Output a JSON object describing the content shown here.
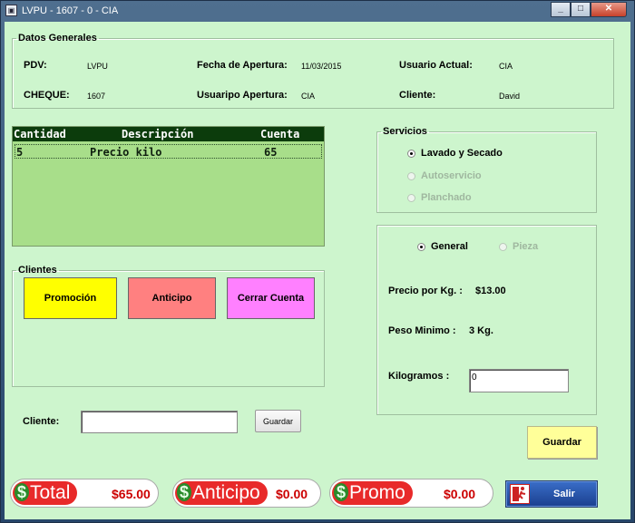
{
  "window": {
    "title": "LVPU - 1607 - 0 - CIA",
    "close_glyph": "✕",
    "minimize_glyph": "_",
    "maximize_glyph": "□"
  },
  "datos_generales": {
    "legend": "Datos Generales",
    "pdv_label": "PDV:",
    "pdv_value": "LVPU",
    "fecha_label": "Fecha de Apertura:",
    "fecha_value": "11/03/2015",
    "usuario_actual_label": "Usuario Actual:",
    "usuario_actual_value": "CIA",
    "cheque_label": "CHEQUE:",
    "cheque_value": "1607",
    "usuario_apertura_label": "Usuaripo Apertura:",
    "usuario_apertura_value": "CIA",
    "cliente_label": "Cliente:",
    "cliente_value": "David"
  },
  "grid": {
    "headers": [
      "Cantidad",
      "Descripción",
      "Cuenta"
    ],
    "rows": [
      {
        "cantidad": "5",
        "descripcion": "Precio kilo",
        "cuenta": "65"
      }
    ]
  },
  "servicios": {
    "legend": "Servicios",
    "options": [
      {
        "label": "Lavado y Secado",
        "selected": true,
        "enabled": true
      },
      {
        "label": "Autoservicio",
        "selected": false,
        "enabled": false
      },
      {
        "label": "Planchado",
        "selected": false,
        "enabled": false
      }
    ]
  },
  "pricing": {
    "general_label": "General",
    "general_selected": true,
    "pieza_label": "Pieza",
    "pieza_enabled": false,
    "precio_label": "Precio por Kg. :",
    "precio_value": "$13.00",
    "peso_label": "Peso Minimo :",
    "peso_value": "3 Kg.",
    "kilogramos_label": "Kilogramos :",
    "kilogramos_value": "0"
  },
  "clientes": {
    "legend": "Clientes",
    "promocion_label": "Promoción",
    "anticipo_label": "Anticipo",
    "cerrar_label": "Cerrar Cuenta",
    "promocion_color": "#ffff00",
    "anticipo_color": "#ff8080",
    "cerrar_color": "#ff80ff"
  },
  "cliente_form": {
    "label": "Cliente:",
    "value": "",
    "guardar_label": "Guardar"
  },
  "guardar_button": {
    "label": "Guardar",
    "color": "#ffff99"
  },
  "totals": {
    "total_label": "Total",
    "total_value": "$65.00",
    "anticipo_label": "Anticipo",
    "anticipo_value": "$0.00",
    "promo_label": "Promo",
    "promo_value": "$0.00",
    "dollar_sign": "$"
  },
  "salir_button": {
    "label": "Salir",
    "icon": "exit-running-man-icon"
  }
}
